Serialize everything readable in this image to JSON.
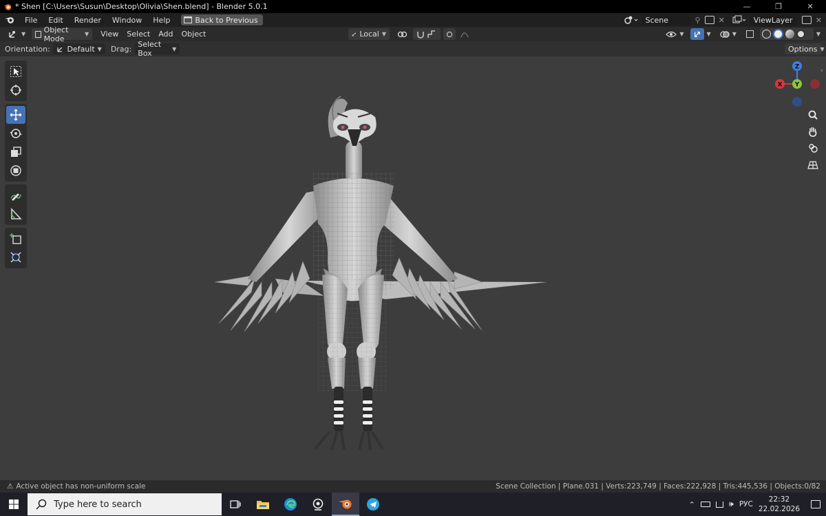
{
  "window": {
    "title": "* Shen [C:\\Users\\Susun\\Desktop\\Olivia\\Shen.blend] - Blender 5.0.1",
    "minimize": "—",
    "maximize": "❐",
    "close": "✕"
  },
  "menubar": {
    "items": [
      "File",
      "Edit",
      "Render",
      "Window",
      "Help"
    ],
    "back_button": "Back to Previous",
    "scene": "Scene",
    "view_layer": "ViewLayer"
  },
  "header": {
    "mode": "Object Mode",
    "menus": [
      "View",
      "Select",
      "Add",
      "Object"
    ],
    "transform_orientation": "Local"
  },
  "tool_settings": {
    "orientation_label": "Orientation:",
    "orientation_value": "Default",
    "drag_label": "Drag:",
    "drag_value": "Select Box",
    "options": "Options"
  },
  "gizmo": {
    "z": "Z",
    "y": "Y",
    "x": "X"
  },
  "status": {
    "warning": "Active object has non-uniform scale",
    "stats": "Scene Collection | Plane.031 | Verts:223,749 | Faces:222,928 | Tris:445,536 | Objects:0/82"
  },
  "taskbar": {
    "search_placeholder": "Type here to search",
    "language": "РУС",
    "time": "22:32",
    "date": "22.02.2026"
  },
  "colors": {
    "active_tool": "#4772b3",
    "axis_x": "#d9363e",
    "axis_y": "#8cc63f",
    "axis_z": "#3d7ee6"
  }
}
